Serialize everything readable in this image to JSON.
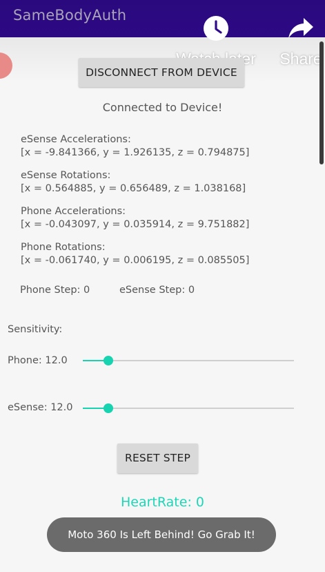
{
  "app": {
    "title": "SameBodyAuth",
    "app_bar_color": "#2f0a8c",
    "accent_color": "#17d3b0"
  },
  "video_overlay": {
    "watch_later_label": "Watch later",
    "watch_later_icon": "clock-icon",
    "share_label": "Share",
    "share_icon": "share-arrow-icon"
  },
  "buttons": {
    "disconnect_label": "DISCONNECT FROM DEVICE",
    "reset_label": "RESET STEP"
  },
  "status_text": "Connected to Device!",
  "sensors": {
    "esense_acc": {
      "label": "eSense Accelerations:",
      "value": "[x = -9.841366, y = 1.926135, z = 0.794875]"
    },
    "esense_rot": {
      "label": "eSense Rotations:",
      "value": "[x = 0.564885, y = 0.656489, z = 1.038168]"
    },
    "phone_acc": {
      "label": "Phone Accelerations:",
      "value": "[x = -0.043097, y = 0.035914, z = 9.751882]"
    },
    "phone_rot": {
      "label": "Phone Rotations:",
      "value": "[x = -0.061740, y = 0.006195, z = 0.085505]"
    }
  },
  "steps": {
    "phone": "Phone Step: 0",
    "esense": "eSense Step: 0"
  },
  "sensitivity": {
    "heading": "Sensitivity:",
    "phone_label": "Phone: 12.0",
    "phone_fraction": 0.12,
    "esense_label": "eSense: 12.0",
    "esense_fraction": 0.12
  },
  "heart_rate": "HeartRate: 0",
  "toast": "Moto 360 Is Left Behind! Go Grab It!"
}
